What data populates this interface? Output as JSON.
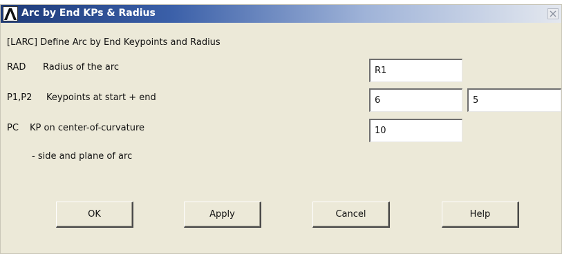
{
  "window": {
    "title": "Arc by End KPs & Radius"
  },
  "header": {
    "text": "[LARC]  Define Arc by End Keypoints and Radius"
  },
  "fields": {
    "rad": {
      "key": "RAD",
      "label": "Radius of the arc",
      "value": "R1"
    },
    "p1p2": {
      "key": "P1,P2",
      "label": "Keypoints at start + end",
      "value1": "6",
      "value2": "5"
    },
    "pc": {
      "key": "PC",
      "label": "KP on center-of-curvature",
      "note": "- side and plane of arc",
      "value": "10"
    }
  },
  "buttons": {
    "ok": "OK",
    "apply": "Apply",
    "cancel": "Cancel",
    "help": "Help"
  },
  "icons": {
    "app": "ansys-logo-icon",
    "close": "close-icon"
  }
}
